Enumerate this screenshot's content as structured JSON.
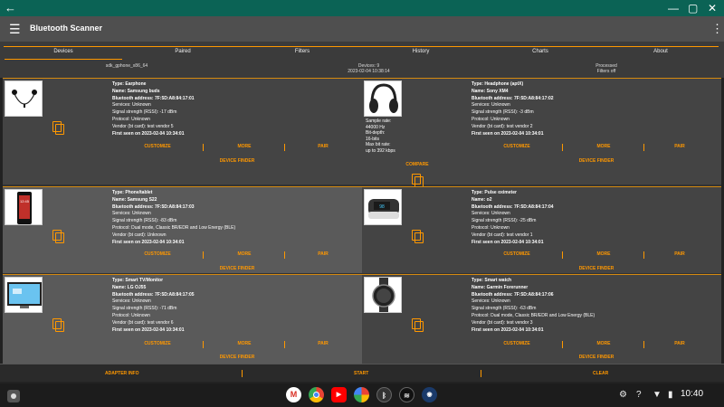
{
  "window": {
    "back_icon": "arrow-back-icon",
    "minimize": "—",
    "maximize": "▢",
    "close": "✕"
  },
  "appbar": {
    "title": "Bluetooth Scanner"
  },
  "tabs": [
    "Devices",
    "Paired",
    "Filters",
    "History",
    "Charts",
    "About"
  ],
  "status": {
    "device_name": "sdk_gphone_x86_64",
    "devices_count": "Devices: 9",
    "timestamp": "2023-02-04 10:38:14",
    "processed": "Processed",
    "filters": "Filters off"
  },
  "buttons": {
    "customize": "CUSTOMIZE",
    "more": "MORE",
    "pair": "PAIR",
    "device_finder": "DEVICE FINDER",
    "compare": "COMPARE"
  },
  "devices": [
    {
      "type": "Type: Earphone",
      "name": "Name: Samsung buds",
      "address": "Bluetooth address: 7F:5D:A8:84:17:01",
      "services": "Services: Unknown",
      "signal": "Signal strength (RSSI): -17 dBm",
      "protocol": "Protocol: Unknown",
      "vendor": "Vendor (bt card): test vendor 5",
      "first_seen": "First seen on 2023-02-04 10:34:01"
    },
    {
      "type": "Type: Headphone (aptX)",
      "name": "Name: Sony XM4",
      "address": "Bluetooth address: 7F:5D:A8:84:17:02",
      "services": "Services: Unknown",
      "signal": "Signal strength (RSSI): -3 dBm",
      "protocol": "Protocol: Unknown",
      "vendor": "Vendor (bt card): test vendor 2",
      "first_seen": "First seen on 2023-02-04 10:34:01",
      "specs": {
        "sample_rate_label": "Sample rate:",
        "sample_rate": "44000 Hz",
        "bit_depth_label": "Bit-depth:",
        "bit_depth": "16-bits",
        "max_bit_rate_label": "Max bit rate:",
        "max_bit_rate": "up to 392 kbps"
      }
    },
    {
      "type": "Type: Phone/tablet",
      "name": "Name: Samsung S22",
      "address": "Bluetooth address: 7F:5D:A8:84:17:03",
      "services": "Services: Unknown",
      "signal": "Signal strength (RSSI): -83 dBm",
      "protocol": "Protocol: Dual mode, Classic BR/EDR and Low Energy (BLE)",
      "vendor": "Vendor (bt card): Unknown",
      "first_seen": "First seen on 2023-02-04 10:34:01"
    },
    {
      "type": "Type: Pulse oximeter",
      "name": "Name: o2",
      "address": "Bluetooth address: 7F:5D:A8:84:17:04",
      "services": "Services: Unknown",
      "signal": "Signal strength (RSSI): -25 dBm",
      "protocol": "Protocol: Unknown",
      "vendor": "Vendor (bt card): test vendor 1",
      "first_seen": "First seen on 2023-02-04 10:34:01"
    },
    {
      "type": "Type: Smart TV/Monitor",
      "name": "Name: LG OJ55",
      "address": "Bluetooth address: 7F:5D:A8:84:17:05",
      "services": "Services: Unknown",
      "signal": "Signal strength (RSSI): -71 dBm",
      "protocol": "Protocol: Unknown",
      "vendor": "Vendor (bt card): test vendor 6",
      "first_seen": "First seen on 2023-02-04 10:34:01"
    },
    {
      "type": "Type: Smart watch",
      "name": "Name: Garmin Forerunner",
      "address": "Bluetooth address: 7F:5D:A8:84:17:06",
      "services": "Services: Unknown",
      "signal": "Signal strength (RSSI): -63 dBm",
      "protocol": "Protocol: Dual mode, Classic BR/EDR and Low Energy (BLE)",
      "vendor": "Vendor (bt card): test vendor 3",
      "first_seen": "First seen on 2023-02-04 10:34:01"
    }
  ],
  "bottom": {
    "adapter_info": "ADAPTER INFO",
    "start": "START",
    "clear": "CLEAR"
  },
  "shelf": {
    "apps": [
      "gmail-icon",
      "chrome-icon",
      "youtube-icon",
      "photos-icon",
      "bluetooth-scanner-icon",
      "wifi-scanner-icon",
      "app-icon"
    ],
    "clock": "10:40"
  },
  "colors": {
    "accent": "#ff9800",
    "titlebar": "#0b6355",
    "appbar": "#4f4f4f"
  }
}
